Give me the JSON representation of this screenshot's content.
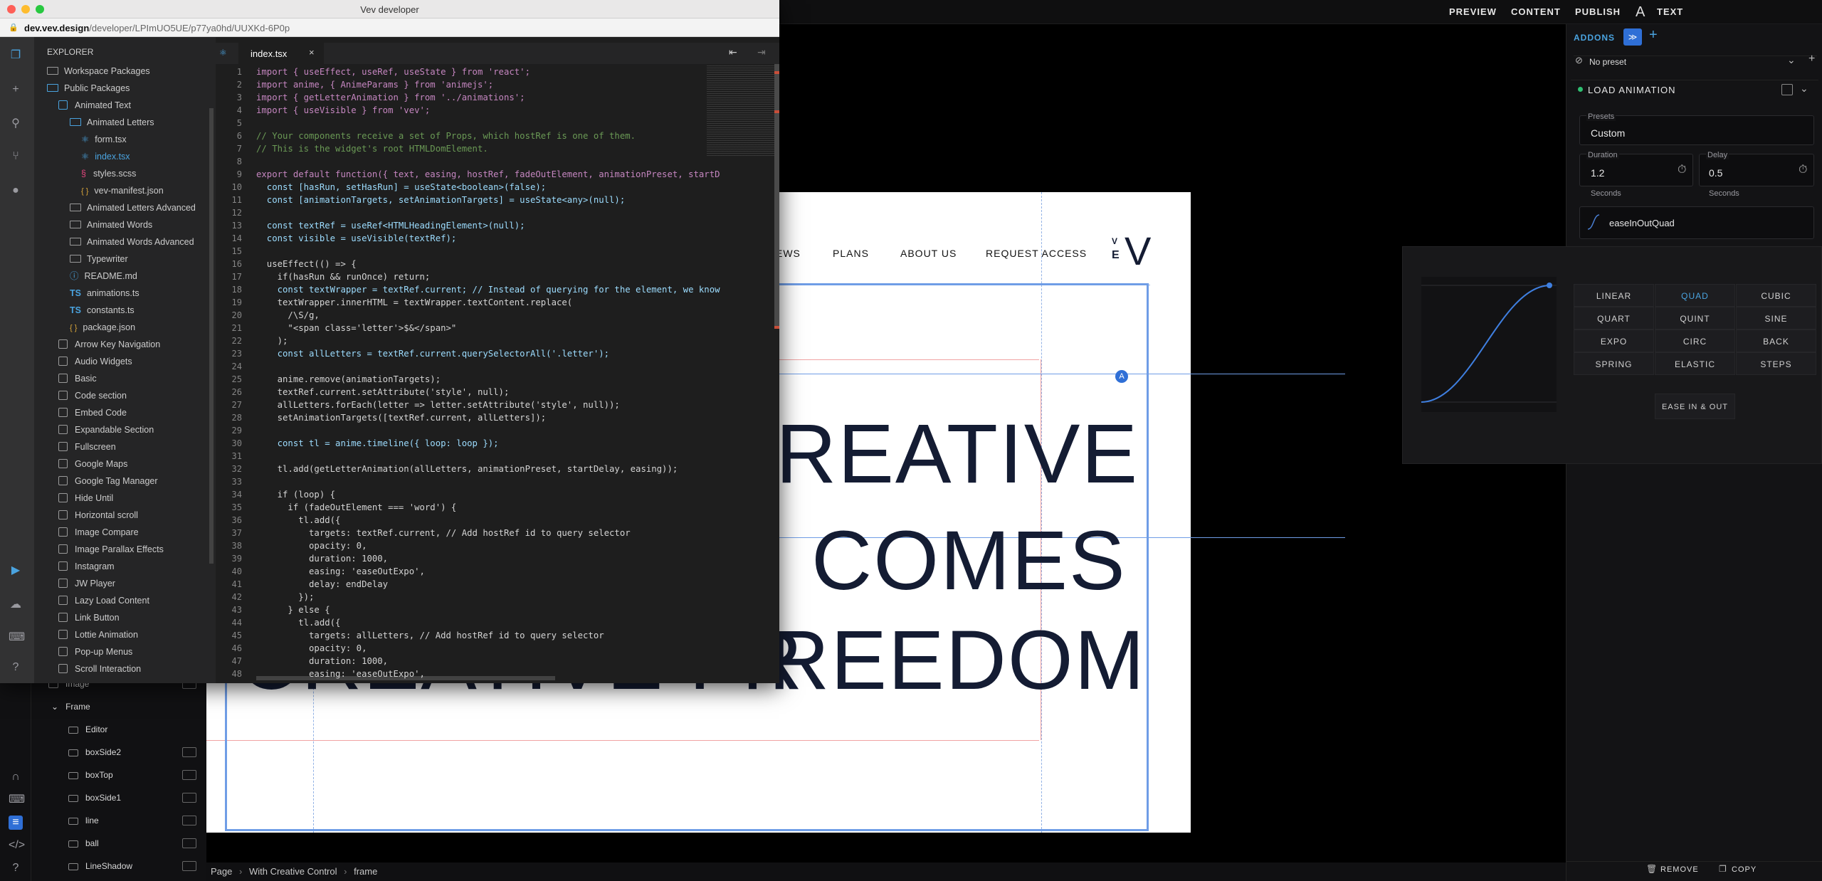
{
  "topbar": {
    "preview": "PREVIEW",
    "content": "CONTENT",
    "publish": "PUBLISH",
    "text_tool": "TEXT"
  },
  "layers": [
    {
      "label": "Image"
    },
    {
      "label": "Frame"
    },
    {
      "label": "Editor"
    },
    {
      "label": "boxSide2"
    },
    {
      "label": "boxTop"
    },
    {
      "label": "boxSide1"
    },
    {
      "label": "line"
    },
    {
      "label": "ball"
    },
    {
      "label": "LineShadow"
    }
  ],
  "site": {
    "nav": [
      "EWS",
      "PLANS",
      "ABOUT US",
      "REQUEST ACCESS"
    ],
    "logo_top": "V",
    "logo_bottom": "E",
    "logo_big": "V",
    "headline": [
      "REATIVE",
      "COMES",
      "REEDOM"
    ],
    "back_text": "CREATIVE FR"
  },
  "breadcrumb": {
    "page": "Page",
    "parent": "With Creative Control",
    "current": "frame"
  },
  "right": {
    "tab": "ADDONS",
    "preset_select": "No preset",
    "section": "LOAD ANIMATION",
    "presets_label": "Presets",
    "presets_value": "Custom",
    "duration_label": "Duration",
    "duration_value": "1.2",
    "duration_unit": "Seconds",
    "delay_label": "Delay",
    "delay_value": "0.5",
    "delay_unit": "Seconds",
    "easing_value": "easeInOutQuad",
    "remove": "REMOVE",
    "copy": "COPY"
  },
  "easing": {
    "options": [
      "LINEAR",
      "QUAD",
      "CUBIC",
      "QUART",
      "QUINT",
      "SINE",
      "EXPO",
      "CIRC",
      "BACK",
      "SPRING",
      "ELASTIC",
      "STEPS"
    ],
    "selected": "QUAD",
    "mode": "EASE IN & OUT"
  },
  "dev": {
    "window_title": "Vev developer",
    "url_host": "dev.vev.design",
    "url_path": "/developer/LPImUO5UE/p77ya0hd/UUXKd-6P0p",
    "explorer_title": "EXPLORER",
    "tab": "index.tsx",
    "tree": [
      "Workspace Packages",
      "Public Packages",
      "Animated Text",
      "Animated Letters",
      "form.tsx",
      "index.tsx",
      "styles.scss",
      "vev-manifest.json",
      "Animated Letters Advanced",
      "Animated Words",
      "Animated Words Advanced",
      "Typewriter",
      "README.md",
      "animations.ts",
      "constants.ts",
      "package.json",
      "Arrow Key Navigation",
      "Audio Widgets",
      "Basic",
      "Code section",
      "Embed Code",
      "Expandable Section",
      "Fullscreen",
      "Google Maps",
      "Google Tag Manager",
      "Hide Until",
      "Horizontal scroll",
      "Image Compare",
      "Image Parallax Effects",
      "Instagram",
      "JW Player",
      "Lazy Load Content",
      "Link Button",
      "Lottie Animation",
      "Pop-up Menus",
      "Scroll Interaction"
    ],
    "ts_badge": "TS",
    "json_badge": "{ }",
    "line_numbers": [
      "1",
      "2",
      "3",
      "4",
      "5",
      "6",
      "7",
      "8",
      "9",
      "10",
      "11",
      "12",
      "13",
      "14",
      "15",
      "16",
      "17",
      "18",
      "19",
      "20",
      "21",
      "22",
      "23",
      "24",
      "25",
      "26",
      "27",
      "28",
      "29",
      "30",
      "31",
      "32",
      "33",
      "34",
      "35",
      "36",
      "37",
      "38",
      "39",
      "40",
      "41",
      "42",
      "43",
      "44",
      "45",
      "46",
      "47",
      "48"
    ],
    "code": [
      "import { useEffect, useRef, useState } from 'react';",
      "import anime, { AnimeParams } from 'animejs';",
      "import { getLetterAnimation } from '../animations';",
      "import { useVisible } from 'vev';",
      "",
      "// Your components receive a set of Props, which hostRef is one of them.",
      "// This is the widget's root HTMLDomElement.",
      "",
      "export default function({ text, easing, hostRef, fadeOutElement, animationPreset, startD",
      "  const [hasRun, setHasRun] = useState<boolean>(false);",
      "  const [animationTargets, setAnimationTargets] = useState<any>(null);",
      "",
      "  const textRef = useRef<HTMLHeadingElement>(null);",
      "  const visible = useVisible(textRef);",
      "",
      "  useEffect(() => {",
      "    if(hasRun && runOnce) return;",
      "    const textWrapper = textRef.current; // Instead of querying for the element, we know",
      "    textWrapper.innerHTML = textWrapper.textContent.replace(",
      "      /\\S/g,",
      "      \"<span class='letter'>$&</span>\"",
      "    );",
      "    const allLetters = textRef.current.querySelectorAll('.letter');",
      "",
      "    anime.remove(animationTargets);",
      "    textRef.current.setAttribute('style', null);",
      "    allLetters.forEach(letter => letter.setAttribute('style', null));",
      "    setAnimationTargets([textRef.current, allLetters]);",
      "",
      "    const tl = anime.timeline({ loop: loop });",
      "",
      "    tl.add(getLetterAnimation(allLetters, animationPreset, startDelay, easing));",
      "",
      "    if (loop) {",
      "      if (fadeOutElement === 'word') {",
      "        tl.add({",
      "          targets: textRef.current, // Add hostRef id to query selector",
      "          opacity: 0,",
      "          duration: 1000,",
      "          easing: 'easeOutExpo',",
      "          delay: endDelay",
      "        });",
      "      } else {",
      "        tl.add({",
      "          targets: allLetters, // Add hostRef id to query selector",
      "          opacity: 0,",
      "          duration: 1000,",
      "          easing: 'easeOutExpo',"
    ]
  }
}
